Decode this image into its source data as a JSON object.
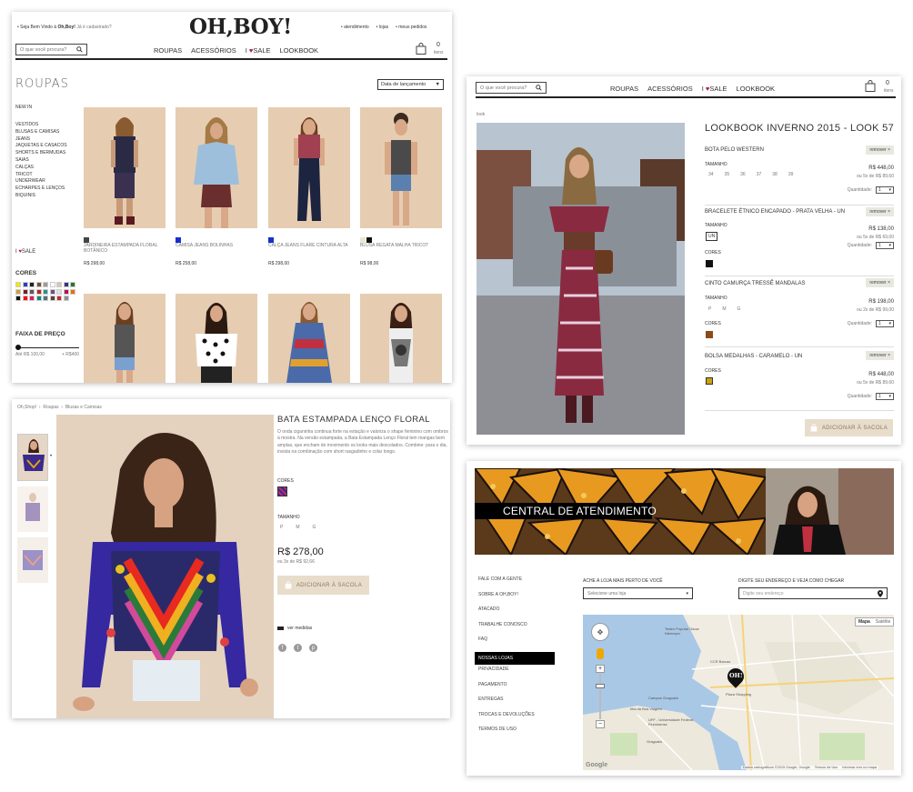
{
  "card1": {
    "welcome_pre": "Seja Bem Vindo à ",
    "welcome_brand": "Oh,Boy!",
    "welcome_post": " Já é cadastrado?",
    "logo": "OH,BOY!",
    "top_links": [
      "atendimento",
      "lojas",
      "meus pedidos"
    ],
    "search_placeholder": "O que você procura?",
    "nav": [
      "ROUPAS",
      "ACESSÓRIOS",
      "SALE",
      "LOOKBOOK"
    ],
    "bag_count": "0",
    "bag_label": "itens",
    "page_title": "ROUPAS",
    "sort_value": "Data de lançamento",
    "categories": [
      "NEW IN",
      "VESTIDOS",
      "BLUSAS E CAMISAS",
      "JEANS",
      "JAQUETAS E CASACOS",
      "SHORTS E BERMUDAS",
      "SAIAS",
      "CALÇAS",
      "TRICOT",
      "UNDERWEAR",
      "ECHARPES E LENÇOS",
      "BIQUINIS"
    ],
    "sale_pre": "I",
    "sale_label": "SALE",
    "colors_title": "CORES",
    "price_title": "FAIXA DE PREÇO",
    "price_min": "Até R$ 100,00",
    "price_max": "+ R$400",
    "color_swatches": [
      "#f2e600",
      "#2342c9",
      "#222222",
      "#7a5230",
      "#9b9b9b",
      "#ffffff",
      "#d7c8a8",
      "#333388",
      "#1d7b2e",
      "#c8a33c",
      "#7c1a30",
      "#5a5a5a",
      "#bb2222",
      "#2d8f8f",
      "#6d4d8f",
      "#e0e0e0",
      "#ad1457",
      "#ef6c00",
      "#111111",
      "#ff0000",
      "#d81b60",
      "#00897b",
      "#546e7a",
      "#5d4037",
      "#c62828",
      "#8e8e8e"
    ],
    "products": [
      {
        "name": "JARDINEIRA ESTAMPADA FLORAL BOTÂNICO",
        "price": "R$ 298,00"
      },
      {
        "name": "CAMISA JEANS BOLINHAS",
        "price": "R$ 258,00"
      },
      {
        "name": "CALÇA JEANS FLARE CINTURA ALTA",
        "price": "R$ 298,00"
      },
      {
        "name": "BLUSA REGATA MALHA TRICOT",
        "price": "R$ 98,00"
      }
    ]
  },
  "card2": {
    "search_placeholder": "O que você procura?",
    "nav": [
      "ROUPAS",
      "ACESSÓRIOS",
      "SALE",
      "LOOKBOOK"
    ],
    "bag_count": "0",
    "bag_label": "itens",
    "crumb": "look",
    "title": "LOOKBOOK INVERNO 2015 - LOOK 57",
    "remove_label": "remover",
    "size_label": "TAMANHO",
    "colors_label": "CORES",
    "qty_label": "Quantidade:",
    "items": [
      {
        "name": "BOTA PELO WESTERN",
        "sizes": [
          "34",
          "35",
          "36",
          "37",
          "38",
          "39"
        ],
        "price": "R$ 448,00",
        "installments": "ou 5x de R$ 89,60",
        "qty": "1",
        "color": ""
      },
      {
        "name": "BRACELETE ÉTNICO ENCAPADO - PRATA VELHA - UN",
        "sizes": [
          "UN"
        ],
        "price": "R$ 138,00",
        "installments": "ou 5x de R$ 69,00",
        "qty": "1",
        "color": "#111111"
      },
      {
        "name": "CINTO CAMURÇA TRESSÊ MANDALAS",
        "sizes": [
          "P",
          "M",
          "G"
        ],
        "price": "R$ 198,00",
        "installments": "ou 2x de R$ 99,00",
        "qty": "1",
        "color": "#8a4a1a"
      },
      {
        "name": "BOLSA MEDALHAS - CARAMELO - UN",
        "sizes": [],
        "price": "R$ 448,00",
        "installments": "ou 5x de R$ 89,60",
        "qty": "1",
        "color": "#c9a210"
      }
    ],
    "add_bag": "ADICIONAR À SACOLA"
  },
  "card3": {
    "breadcrumb": [
      "Oh,Shop!",
      "Roupas",
      "Blusas e Camisas"
    ],
    "title": "BATA ESTAMPADA LENÇO FLORAL",
    "description": "O onda ciganinha continua forte na estação e valoriza o shape feminino com ombros à mostra. Na versão estampada, a Bata Estampada Lenço Floral tem mangas bem amplas, que encham de movimento os looks mais descolados. Combine: para o dia, invista na combinação com short rasgadinho e colar longo.",
    "colors_label": "CORES",
    "size_label": "TAMANHO",
    "sizes": [
      "P",
      "M",
      "G"
    ],
    "price": "R$ 278,00",
    "installments": "ou 3x de R$ 92,66",
    "add_bag": "ADICIONAR À SACOLA",
    "measures": "ver medidas",
    "social": [
      "f",
      "t",
      "p"
    ]
  },
  "card4": {
    "banner_title": "CENTRAL DE ATENDIMENTO",
    "menu": [
      "FALE COM A GENTE",
      "SOBRE A OH,BOY!",
      "ATACADO",
      "TRABALHE CONOSCO",
      "FAQ",
      "NOSSAS LOJAS",
      "PRIVACIDADE",
      "PAGAMENTO",
      "ENTREGAS",
      "TROCAS E DEVOLUÇÕES",
      "TERMOS DE USO"
    ],
    "active_index": 5,
    "store_label": "ACHE A LOJA MAIS PERTO DE VOCÊ",
    "store_select": "Selecione uma loja",
    "address_label": "DIGITE SEU ENDEREÇO E VEJA COMO CHEGAR",
    "address_placeholder": "Digite seu endereço",
    "map_types": [
      "Mapa",
      "Satélite"
    ],
    "map_pin": "OH!",
    "map_labels": [
      "Teatro Popular Oscar Niemeyer",
      "Plaza Shopping",
      "CCR Barcas",
      "Ilha da Boa Viagem",
      "Campus Gragoatá",
      "UFF - Universidade Federal Fluminense",
      "Gragoatá"
    ],
    "map_footer": [
      "Dados cartográficos ©2015 Google, Google",
      "Termos de Uso",
      "Informar erro no mapa"
    ],
    "google": "Google"
  },
  "colors": {
    "accent": "#b01e3c",
    "button_bg": "#e8dccb",
    "button_text": "#8a7a62",
    "active_menu": "#000000"
  }
}
